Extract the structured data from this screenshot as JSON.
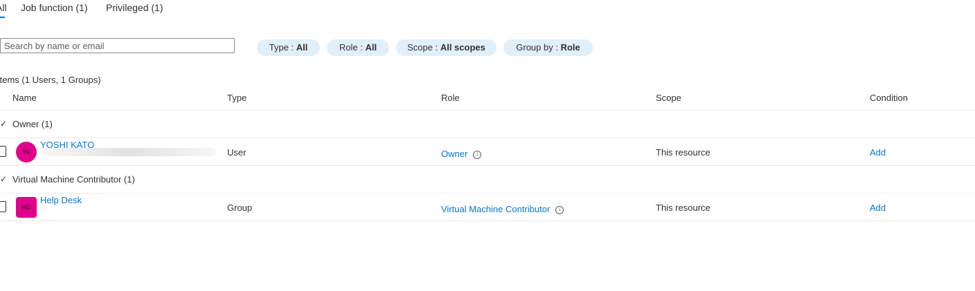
{
  "tabs": [
    {
      "label": "All"
    },
    {
      "label": "Job function (1)"
    },
    {
      "label": "Privileged (1)"
    }
  ],
  "search": {
    "placeholder": "Search by name or email",
    "value": ""
  },
  "filters": {
    "type": {
      "label": "Type : ",
      "value": "All"
    },
    "role": {
      "label": "Role : ",
      "value": "All"
    },
    "scope": {
      "label": "Scope : ",
      "value": "All scopes"
    },
    "group_by": {
      "label": "Group by : ",
      "value": "Role"
    }
  },
  "items_count": "Items (1 Users, 1 Groups)",
  "columns": {
    "name": "Name",
    "type": "Type",
    "role": "Role",
    "scope": "Scope",
    "condition": "Condition"
  },
  "groups": [
    {
      "label": "Owner (1)",
      "row": {
        "initials": "YK",
        "name": "YOSHI KATO",
        "type": "User",
        "role": "Owner",
        "scope": "This resource",
        "condition": "Add"
      }
    },
    {
      "label": "Virtual Machine Contributor (1)",
      "row": {
        "initials": "HD",
        "name": "Help Desk",
        "type": "Group",
        "role": "Virtual Machine Contributor",
        "scope": "This resource",
        "condition": "Add"
      }
    }
  ],
  "icons": {
    "chevron": "chevron-down-icon",
    "info": "info-icon"
  },
  "colors": {
    "accent": "#0078d4",
    "avatar": "#e3008c",
    "pill": "#e1effa"
  }
}
